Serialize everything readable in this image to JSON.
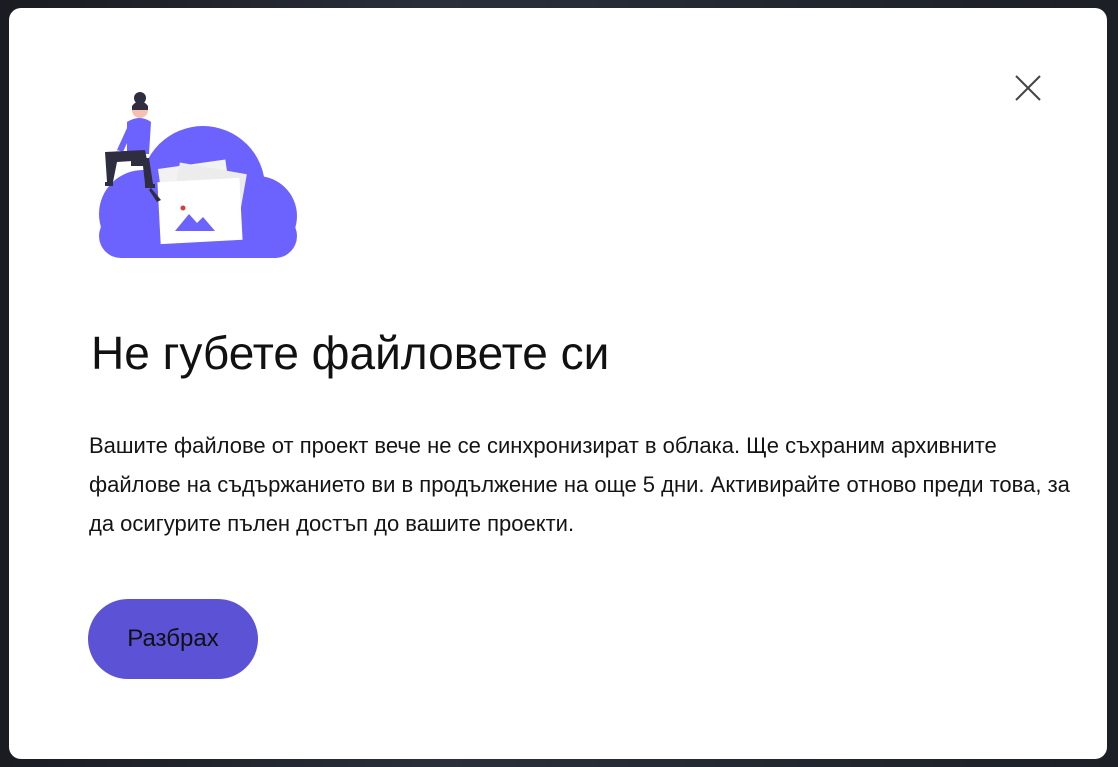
{
  "dialog": {
    "title": "Не губете файловете си",
    "message": "Вашите файлове от проект вече не се синхронизират в облака. Ще съхраним архивните файлове на съдържанието ви в продължение на още 5 дни. Активирайте отново преди това, за да осигурите пълен достъп до вашите проекти.",
    "primary_button_label": "Разбрах",
    "close_icon": "close-icon",
    "illustration_icon": "cloud-upload-illustration"
  },
  "colors": {
    "accent": "#5b52d6",
    "cloud": "#6c63ff",
    "dialog_bg": "#ffffff",
    "text": "#111111"
  }
}
